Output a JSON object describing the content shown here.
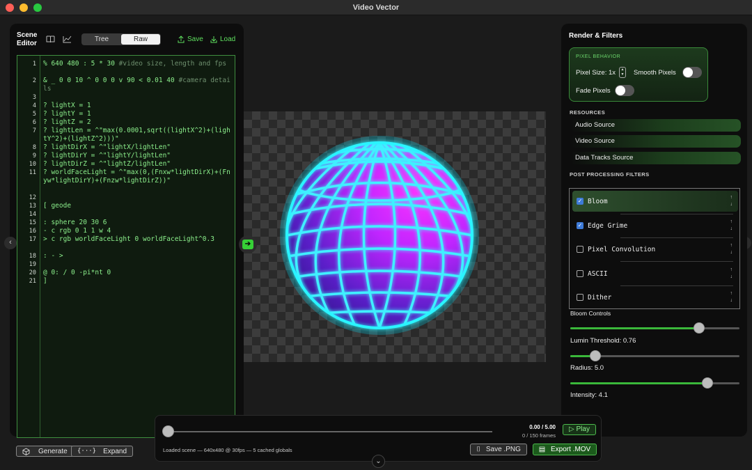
{
  "window": {
    "title": "Video Vector"
  },
  "editor": {
    "title_line1": "Scene",
    "title_line2": "Editor",
    "tab_tree": "Tree",
    "tab_raw": "Raw",
    "save_label": "Save",
    "load_label": "Load",
    "generate_label": "Generate",
    "expand_label": "Expand",
    "lines": [
      {
        "n": "1",
        "code": "% 640 480 : 5 * 30 ",
        "comment": "#video size, length and fps"
      },
      {
        "n": "2",
        "code": "& _ 0 0 10 ^ 0 0 0 v 90 < 0.01 40 ",
        "comment": "#camera details"
      },
      {
        "n": "3",
        "code": "",
        "comment": ""
      },
      {
        "n": "4",
        "code": "? lightX = 1",
        "comment": ""
      },
      {
        "n": "5",
        "code": "? lightY = 1",
        "comment": ""
      },
      {
        "n": "6",
        "code": "? lightZ = 2",
        "comment": ""
      },
      {
        "n": "7",
        "code": "? lightLen = ^\"max(0.0001,sqrt((lightX^2)+(lightY^2)+(lightZ^2)))\"",
        "comment": ""
      },
      {
        "n": "8",
        "code": "? lightDirX = ^\"lightX/lightLen\"",
        "comment": ""
      },
      {
        "n": "9",
        "code": "? lightDirY = ^\"lightY/lightLen\"",
        "comment": ""
      },
      {
        "n": "10",
        "code": "? lightDirZ = ^\"lightZ/lightLen\"",
        "comment": ""
      },
      {
        "n": "11",
        "code": "? worldFaceLight = ^\"max(0,(Fnxw*lightDirX)+(Fnyw*lightDirY)+(Fnzw*lightDirZ))\"",
        "comment": ""
      },
      {
        "n": "12",
        "code": "",
        "comment": ""
      },
      {
        "n": "13",
        "code": "[ geode",
        "comment": ""
      },
      {
        "n": "14",
        "code": "",
        "comment": ""
      },
      {
        "n": "15",
        "code": ": sphere 20 30 6",
        "comment": ""
      },
      {
        "n": "16",
        "code": "- c rgb 0 1 1 w 4",
        "comment": ""
      },
      {
        "n": "17",
        "code": "> c rgb worldFaceLight 0 worldFaceLight^0.3",
        "comment": ""
      },
      {
        "n": "18",
        "code": ": - >",
        "comment": ""
      },
      {
        "n": "19",
        "code": "",
        "comment": ""
      },
      {
        "n": "20",
        "code": "@ 0: / 0 -pi*nt 0",
        "comment": ""
      },
      {
        "n": "21",
        "code": "]",
        "comment": ""
      }
    ]
  },
  "render": {
    "title": "Render & Filters",
    "pixel_behavior_label": "PIXEL BEHAVIOR",
    "pixel_size_label": "Pixel Size: 1x",
    "smooth_pixels_label": "Smooth Pixels",
    "smooth_pixels_on": false,
    "fade_pixels_label": "Fade Pixels",
    "fade_pixels_on": false,
    "resources_label": "RESOURCES",
    "resources": [
      "Audio Source",
      "Video Source",
      "Data Tracks Source"
    ],
    "filters_label": "POST PROCESSING FILTERS",
    "filters": [
      {
        "name": "Bloom",
        "checked": true
      },
      {
        "name": "Edge Grime",
        "checked": true
      },
      {
        "name": "Pixel Convolution",
        "checked": false
      },
      {
        "name": "ASCII",
        "checked": false
      },
      {
        "name": "Dither",
        "checked": false
      }
    ],
    "bloom_controls_label": "Bloom Controls",
    "lumin_threshold_label": "Lumin Threshold: 0.76",
    "lumin_threshold": 0.76,
    "radius_label": "Radius: 5.0",
    "radius_fraction": 0.15,
    "intensity_label": "Intensity: 4.1",
    "intensity_fraction": 0.81,
    "accent": "#3ab83a"
  },
  "timeline": {
    "time": "0.00 / 5.00",
    "frames": "0 / 150 frames",
    "play_label": "Play",
    "status": "Loaded scene — 640x480 @ 30fps — 5 cached globals",
    "save_png_label": "Save .PNG",
    "export_mov_label": "Export .MOV",
    "progress": 0
  },
  "icons": [
    "book-icon",
    "chart-icon",
    "upload-icon",
    "download-icon",
    "cube-icon",
    "braces-icon",
    "camera-icon",
    "film-icon",
    "play-icon",
    "chevron-left-icon",
    "chevron-right-icon",
    "chevron-down-icon",
    "toggle-panel-icon"
  ]
}
